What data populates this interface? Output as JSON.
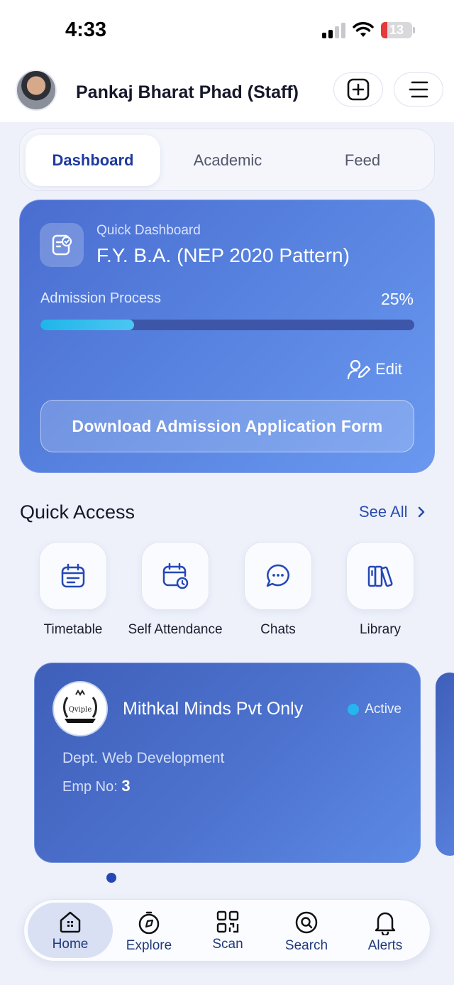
{
  "status_bar": {
    "time": "4:33",
    "battery": "13"
  },
  "header": {
    "user_name": "Pankaj Bharat Phad (Staff)"
  },
  "tabs": [
    {
      "label": "Dashboard",
      "active": true
    },
    {
      "label": "Academic",
      "active": false
    },
    {
      "label": "Feed",
      "active": false
    }
  ],
  "dashboard_card": {
    "label": "Quick Dashboard",
    "title": "F.Y. B.A. (NEP 2020 Pattern)",
    "progress_label": "Admission Process",
    "progress_text": "25%",
    "progress_fraction": 0.25,
    "edit_label": "Edit",
    "download_label": "Download Admission Application Form"
  },
  "quick_access": {
    "title": "Quick Access",
    "see_all": "See All",
    "items": [
      {
        "label": "Timetable",
        "icon": "calendar-icon"
      },
      {
        "label": "Self Attendance",
        "icon": "calendar-clock-icon"
      },
      {
        "label": "Chats",
        "icon": "chat-bubble-icon"
      },
      {
        "label": "Library",
        "icon": "books-icon"
      }
    ]
  },
  "org_card": {
    "logo_text": "Qviple",
    "name": "Mithkal Minds Pvt Only",
    "status": "Active",
    "dept": "Dept. Web Development",
    "emp_label": "Emp No:",
    "emp_no": "3"
  },
  "bottom_nav": [
    {
      "label": "Home",
      "icon": "home-icon",
      "active": true
    },
    {
      "label": "Explore",
      "icon": "compass-icon",
      "active": false
    },
    {
      "label": "Scan",
      "icon": "qr-code-icon",
      "active": false
    },
    {
      "label": "Search",
      "icon": "search-icon",
      "active": false
    },
    {
      "label": "Alerts",
      "icon": "bell-icon",
      "active": false
    }
  ],
  "colors": {
    "accent": "#1f3a9e",
    "card_blue": "#5a86e2",
    "progress": "#1fb6e9",
    "active_dot": "#25b6f0"
  }
}
